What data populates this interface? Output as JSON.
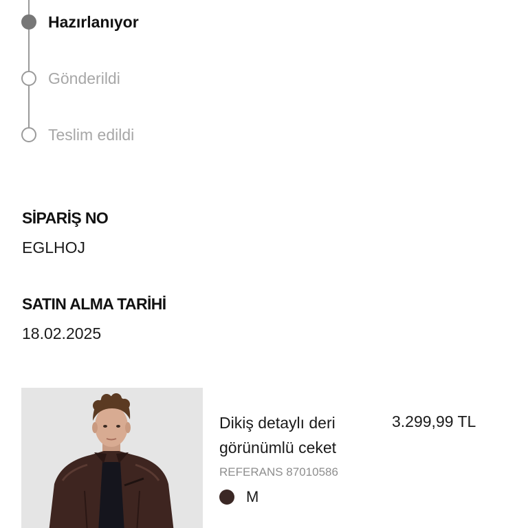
{
  "status_timeline": {
    "steps": [
      {
        "label": "Hazırlanıyor",
        "state": "active"
      },
      {
        "label": "Gönderildi",
        "state": "pending"
      },
      {
        "label": "Teslim edildi",
        "state": "pending"
      }
    ]
  },
  "order": {
    "number_label": "SİPARİŞ NO",
    "number_value": "EGLHOJ",
    "date_label": "SATIN ALMA TARİHİ",
    "date_value": "18.02.2025"
  },
  "product": {
    "name": "Dikiş detaylı deri görünümlü ceket",
    "price": "3.299,99 TL",
    "reference": "REFERANS 87010586",
    "color_hex": "#3b2825",
    "size": "M",
    "image_icon": "product-photo-leather-jacket"
  },
  "colors": {
    "active_step": "#777777",
    "pending_step": "#a7a7a7",
    "text": "#111111"
  }
}
